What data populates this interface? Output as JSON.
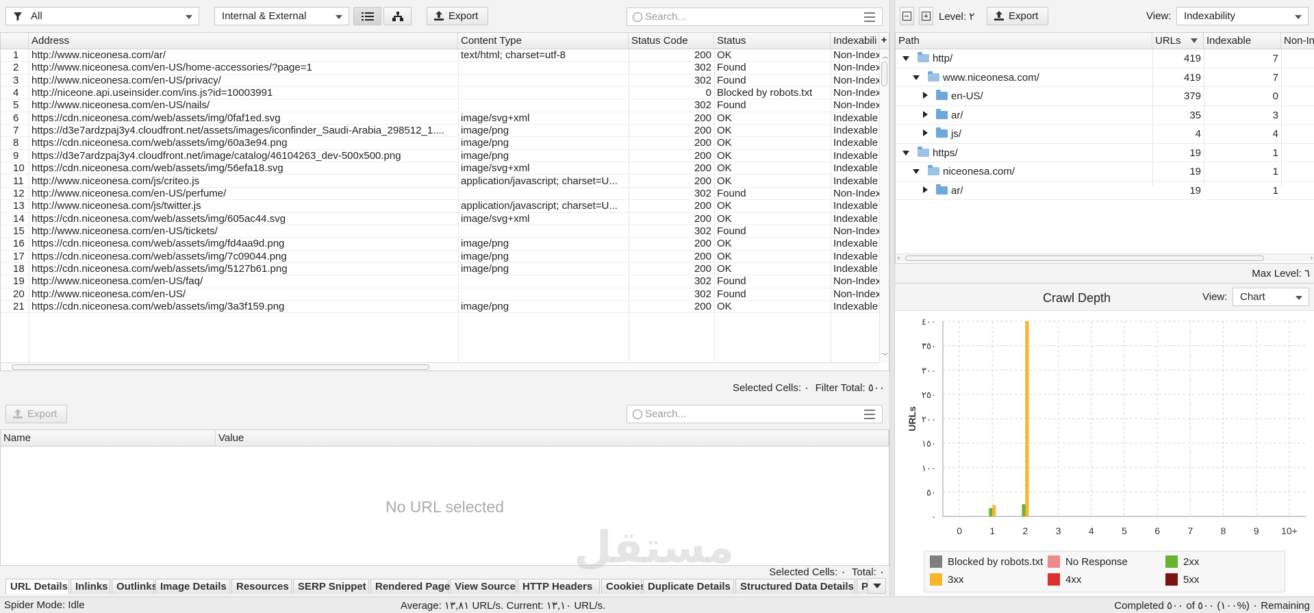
{
  "colors": {
    "accent": "#f9b52b",
    "ok2xx": "#6ab32e",
    "redirect3xx": "#f9b52b",
    "blocked": "#7f7f7f",
    "no_response": "#f08a8a",
    "c4xx": "#dc2f2f",
    "c5xx": "#7a1212",
    "folder": "#6fa8dc"
  },
  "top_toolbar": {
    "filter_value": "All",
    "scope_value": "Internal & External",
    "list_view_icon": "list-icon",
    "tree_view_icon": "tree-icon",
    "export_label": "Export",
    "search_placeholder": "Search..."
  },
  "main_table": {
    "columns": [
      "Address",
      "Content Type",
      "Status Code",
      "Status",
      "Indexabili"
    ],
    "rows": [
      [
        "1",
        "http://www.niceonesa.com/ar/",
        "text/html; charset=utf-8",
        "200",
        "OK",
        "Non-Index"
      ],
      [
        "2",
        "http://www.niceonesa.com/en-US/home-accessories/?page=1",
        "",
        "302",
        "Found",
        "Non-Index"
      ],
      [
        "3",
        "http://www.niceonesa.com/en-US/privacy/",
        "",
        "302",
        "Found",
        "Non-Index"
      ],
      [
        "4",
        "http://niceone.api.useinsider.com/ins.js?id=10003991",
        "",
        "0",
        "Blocked by robots.txt",
        "Non-Index"
      ],
      [
        "5",
        "http://www.niceonesa.com/en-US/nails/",
        "",
        "302",
        "Found",
        "Non-Index"
      ],
      [
        "6",
        "https://cdn.niceonesa.com/web/assets/img/0faf1ed.svg",
        "image/svg+xml",
        "200",
        "OK",
        "Indexable"
      ],
      [
        "7",
        "https://d3e7ardzpaj3y4.cloudfront.net/assets/images/iconfinder_Saudi-Arabia_298512_1....",
        "image/png",
        "200",
        "OK",
        "Indexable"
      ],
      [
        "8",
        "https://cdn.niceonesa.com/web/assets/img/60a3e94.png",
        "image/png",
        "200",
        "OK",
        "Indexable"
      ],
      [
        "9",
        "https://d3e7ardzpaj3y4.cloudfront.net/image/catalog/46104263_dev-500x500.png",
        "image/png",
        "200",
        "OK",
        "Indexable"
      ],
      [
        "10",
        "https://cdn.niceonesa.com/web/assets/img/56efa18.svg",
        "image/svg+xml",
        "200",
        "OK",
        "Indexable"
      ],
      [
        "11",
        "http://www.niceonesa.com/js/criteo.js",
        "application/javascript; charset=U...",
        "200",
        "OK",
        "Indexable"
      ],
      [
        "12",
        "http://www.niceonesa.com/en-US/perfume/",
        "",
        "302",
        "Found",
        "Non-Index"
      ],
      [
        "13",
        "http://www.niceonesa.com/js/twitter.js",
        "application/javascript; charset=U...",
        "200",
        "OK",
        "Indexable"
      ],
      [
        "14",
        "https://cdn.niceonesa.com/web/assets/img/605ac44.svg",
        "image/svg+xml",
        "200",
        "OK",
        "Indexable"
      ],
      [
        "15",
        "http://www.niceonesa.com/en-US/tickets/",
        "",
        "302",
        "Found",
        "Non-Index"
      ],
      [
        "16",
        "https://cdn.niceonesa.com/web/assets/img/fd4aa9d.png",
        "image/png",
        "200",
        "OK",
        "Indexable"
      ],
      [
        "17",
        "https://cdn.niceonesa.com/web/assets/img/7c09044.png",
        "image/png",
        "200",
        "OK",
        "Indexable"
      ],
      [
        "18",
        "https://cdn.niceonesa.com/web/assets/img/5127b61.png",
        "image/png",
        "200",
        "OK",
        "Indexable"
      ],
      [
        "19",
        "http://www.niceonesa.com/en-US/faq/",
        "",
        "302",
        "Found",
        "Non-Index"
      ],
      [
        "20",
        "http://www.niceonesa.com/en-US/",
        "",
        "302",
        "Found",
        "Non-Index"
      ],
      [
        "21",
        "https://cdn.niceonesa.com/web/assets/img/3a3f159.png",
        "image/png",
        "200",
        "OK",
        "Indexable"
      ]
    ],
    "add_column_icon": "plus-icon",
    "status_text": "Selected Cells: ٠  Filter Total: ٥٠٠"
  },
  "detail_panel": {
    "export_label": "Export",
    "search_placeholder": "Search...",
    "columns": [
      "Name",
      "Value"
    ],
    "empty_message": "No URL selected",
    "status_text": "Selected Cells: ٠  Total: ٠"
  },
  "bottom_tabs": [
    "URL Details",
    "Inlinks",
    "Outlinks",
    "Image Details",
    "Resources",
    "SERP Snippet",
    "Rendered Page",
    "View Source",
    "HTTP Headers",
    "Cookies",
    "Duplicate Details",
    "Structured Data Details",
    "P"
  ],
  "status_bar": {
    "mode": "Spider Mode: Idle",
    "speed": "Average: ١٣,٨١ URL/s. Current: ١٣,١٠ URL/s.",
    "progress": "Completed ٥٠٠ of ٠ (%١٠٠) ٥٠٠ Remaining"
  },
  "right_top": {
    "level_label": "Level: ٢",
    "export_label": "Export",
    "view_label": "View:",
    "view_value": "Indexability",
    "columns": [
      "Path",
      "URLs",
      "Indexable",
      "Non-In"
    ],
    "tree": [
      {
        "path": "http/",
        "urls": "419",
        "indexable": "7",
        "depth": 0,
        "expanded": true
      },
      {
        "path": "www.niceonesa.com/",
        "urls": "419",
        "indexable": "7",
        "depth": 1,
        "expanded": true
      },
      {
        "path": "en-US/",
        "urls": "379",
        "indexable": "0",
        "depth": 2,
        "expanded": false
      },
      {
        "path": "ar/",
        "urls": "35",
        "indexable": "3",
        "depth": 2,
        "expanded": false
      },
      {
        "path": "js/",
        "urls": "4",
        "indexable": "4",
        "depth": 2,
        "expanded": false
      },
      {
        "path": "https/",
        "urls": "19",
        "indexable": "1",
        "depth": 0,
        "expanded": true
      },
      {
        "path": "niceonesa.com/",
        "urls": "19",
        "indexable": "1",
        "depth": 1,
        "expanded": true
      },
      {
        "path": "ar/",
        "urls": "19",
        "indexable": "1",
        "depth": 2,
        "expanded": false
      }
    ],
    "max_level": "Max Level: ٦"
  },
  "crawl_depth": {
    "title": "Crawl Depth",
    "view_label": "View:",
    "view_value": "Chart"
  },
  "chart_data": {
    "type": "bar",
    "title": "",
    "ylabel": "URLs",
    "xlabel": "",
    "categories": [
      "0",
      "1",
      "2",
      "3",
      "4",
      "5",
      "6",
      "7",
      "8",
      "9",
      "10+"
    ],
    "ytick_labels": [
      "٠",
      "٥٠",
      "١٠٠",
      "١٥٠",
      "٢٠٠",
      "٢٥٠",
      "٣٠٠",
      "٣٥٠",
      "٤٠٠"
    ],
    "ylim": [
      0,
      400
    ],
    "grid": true,
    "legend_position": "bottom",
    "series": [
      {
        "name": "Blocked by robots.txt",
        "color": "#7f7f7f",
        "values": [
          0,
          0,
          0,
          0,
          0,
          0,
          0,
          0,
          0,
          0,
          0
        ]
      },
      {
        "name": "No Response",
        "color": "#f08a8a",
        "values": [
          0,
          0,
          0,
          0,
          0,
          0,
          0,
          0,
          0,
          0,
          0
        ]
      },
      {
        "name": "2xx",
        "color": "#6ab32e",
        "values": [
          0,
          17,
          25,
          0,
          0,
          0,
          0,
          0,
          0,
          0,
          0
        ]
      },
      {
        "name": "3xx",
        "color": "#f9b52b",
        "values": [
          0,
          23,
          400,
          0,
          0,
          0,
          0,
          0,
          0,
          0,
          0
        ]
      },
      {
        "name": "4xx",
        "color": "#dc2f2f",
        "values": [
          0,
          0,
          0,
          0,
          0,
          0,
          0,
          0,
          0,
          0,
          0
        ]
      },
      {
        "name": "5xx",
        "color": "#7a1212",
        "values": [
          0,
          0,
          0,
          0,
          0,
          0,
          0,
          0,
          0,
          0,
          0
        ]
      }
    ]
  },
  "watermark": "مستقل"
}
